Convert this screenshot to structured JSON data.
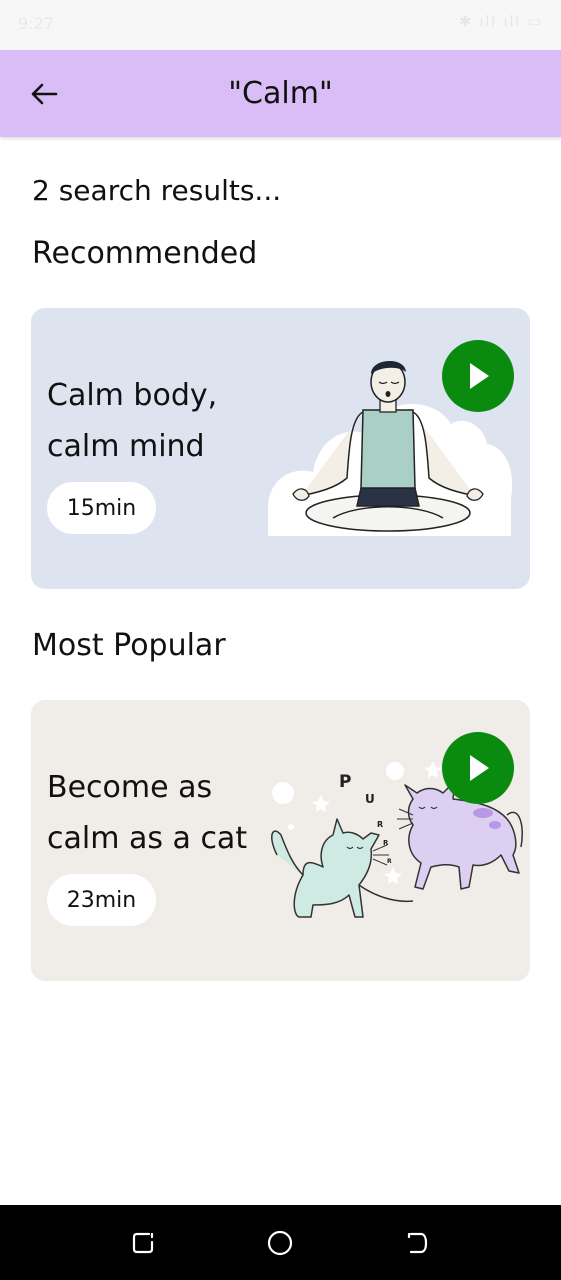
{
  "status_bar": {
    "time": "9:27",
    "icons": "✱ ıll ıll ▭"
  },
  "header": {
    "title": "\"Calm\"",
    "back_icon": "arrow-left-icon",
    "background": "#d9bdf7"
  },
  "search": {
    "results_count": "2 search results..."
  },
  "sections": [
    {
      "heading": "Recommended",
      "card": {
        "title": "Calm body, calm mind",
        "duration": "15min",
        "background": "#dde4f0",
        "illustration": "meditation-illustration"
      }
    },
    {
      "heading": "Most Popular",
      "card": {
        "title": "Become as calm as a cat",
        "duration": "23min",
        "background": "#f0ece8",
        "illustration": "cats-illustration",
        "purr_letters": [
          "P",
          "U",
          "R",
          "R",
          "R"
        ]
      }
    }
  ],
  "colors": {
    "play_button": "#0a8a0f",
    "nav_bar": "#000000"
  },
  "nav_bar": {
    "icons": [
      "recent-apps-icon",
      "home-icon",
      "back-icon"
    ]
  }
}
